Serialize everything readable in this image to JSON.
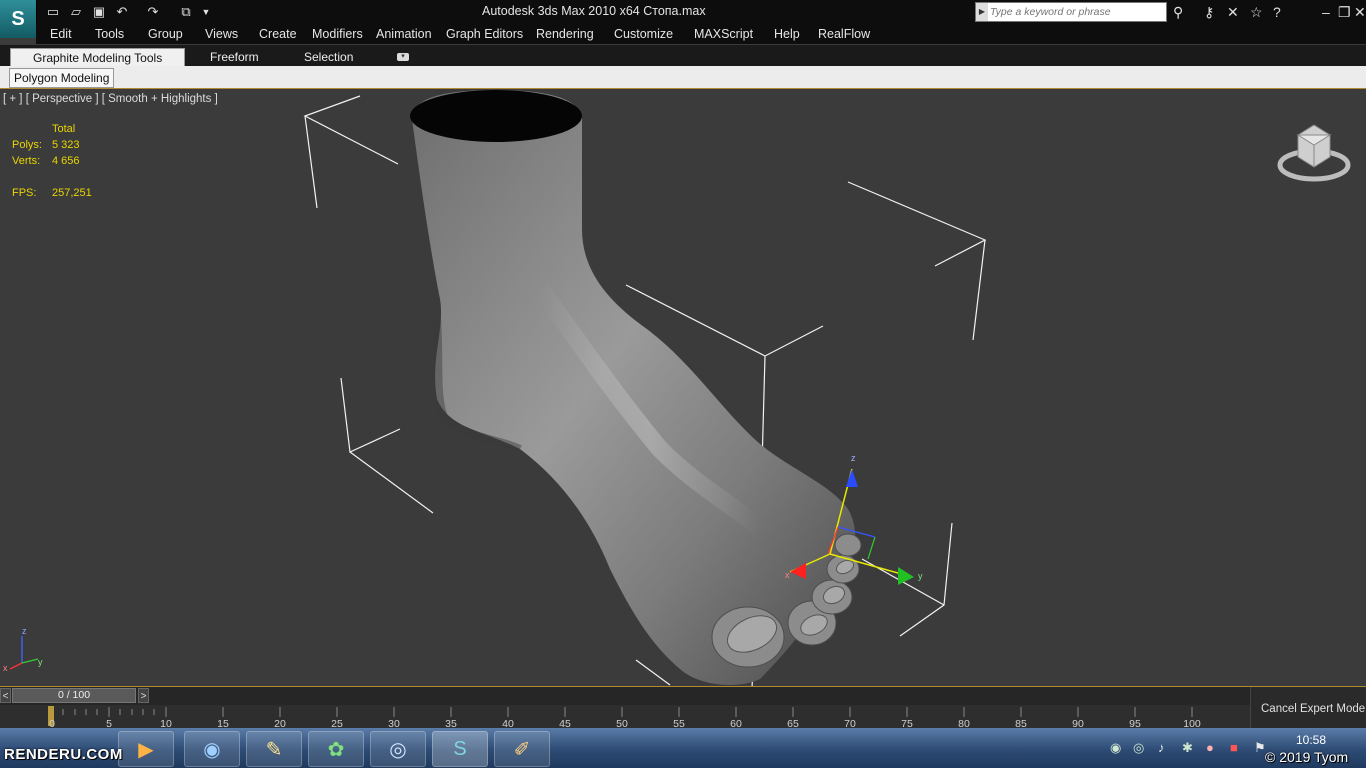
{
  "titlebar": {
    "app_icon": "3ds-max-app-icon",
    "title": "Autodesk 3ds Max  2010 x64        Стопа.max",
    "search_placeholder": "Type a keyword or phrase",
    "quick_access": [
      "new-file-icon",
      "open-file-icon",
      "save-icon",
      "undo-icon",
      "redo-icon",
      "project-folder-icon"
    ],
    "right_icons": [
      "binoculars-icon",
      "key-icon",
      "communication-icon",
      "favorites-star-icon",
      "help-icon"
    ],
    "window_controls": [
      "minimize-icon",
      "restore-icon",
      "close-icon"
    ]
  },
  "menubar": {
    "items": [
      "Edit",
      "Tools",
      "Group",
      "Views",
      "Create",
      "Modifiers",
      "Animation",
      "Graph Editors",
      "Rendering",
      "Customize",
      "MAXScript",
      "Help",
      "RealFlow"
    ]
  },
  "ribbon": {
    "tabs": [
      "Graphite Modeling Tools",
      "Freeform",
      "Selection"
    ],
    "active_tab": "Graphite Modeling Tools",
    "panel_tab": "Polygon Modeling"
  },
  "viewport": {
    "label": "[ + ] [ Perspective ] [ Smooth + Highlights ]",
    "stats": {
      "header": "Total",
      "polys_label": "Polys:",
      "polys_value": "5 323",
      "verts_label": "Verts:",
      "verts_value": "4 656",
      "fps_label": "FPS:",
      "fps_value": "257,251"
    },
    "gizmo_axes": [
      "x",
      "y",
      "z"
    ],
    "corner_axes": [
      "x",
      "y",
      "z"
    ]
  },
  "timeline": {
    "prev": "<",
    "next": ">",
    "frame": "0 / 100",
    "ticks": [
      "0",
      "5",
      "10",
      "15",
      "20",
      "25",
      "30",
      "35",
      "40",
      "45",
      "50",
      "55",
      "60",
      "65",
      "70",
      "75",
      "80",
      "85",
      "90",
      "95",
      "100"
    ]
  },
  "status": {
    "cancel_expert_mode": "Cancel Expert Mode"
  },
  "taskbar": {
    "apps": [
      "media-player-icon",
      "browser-icon",
      "pencil-app-icon",
      "icq-icon",
      "chrome-icon",
      "3ds-max-icon",
      "paint-icon"
    ],
    "clock": "10:58"
  },
  "watermark": {
    "logo": "RENDERU.COM",
    "copyright": "© 2019 Tyom"
  }
}
